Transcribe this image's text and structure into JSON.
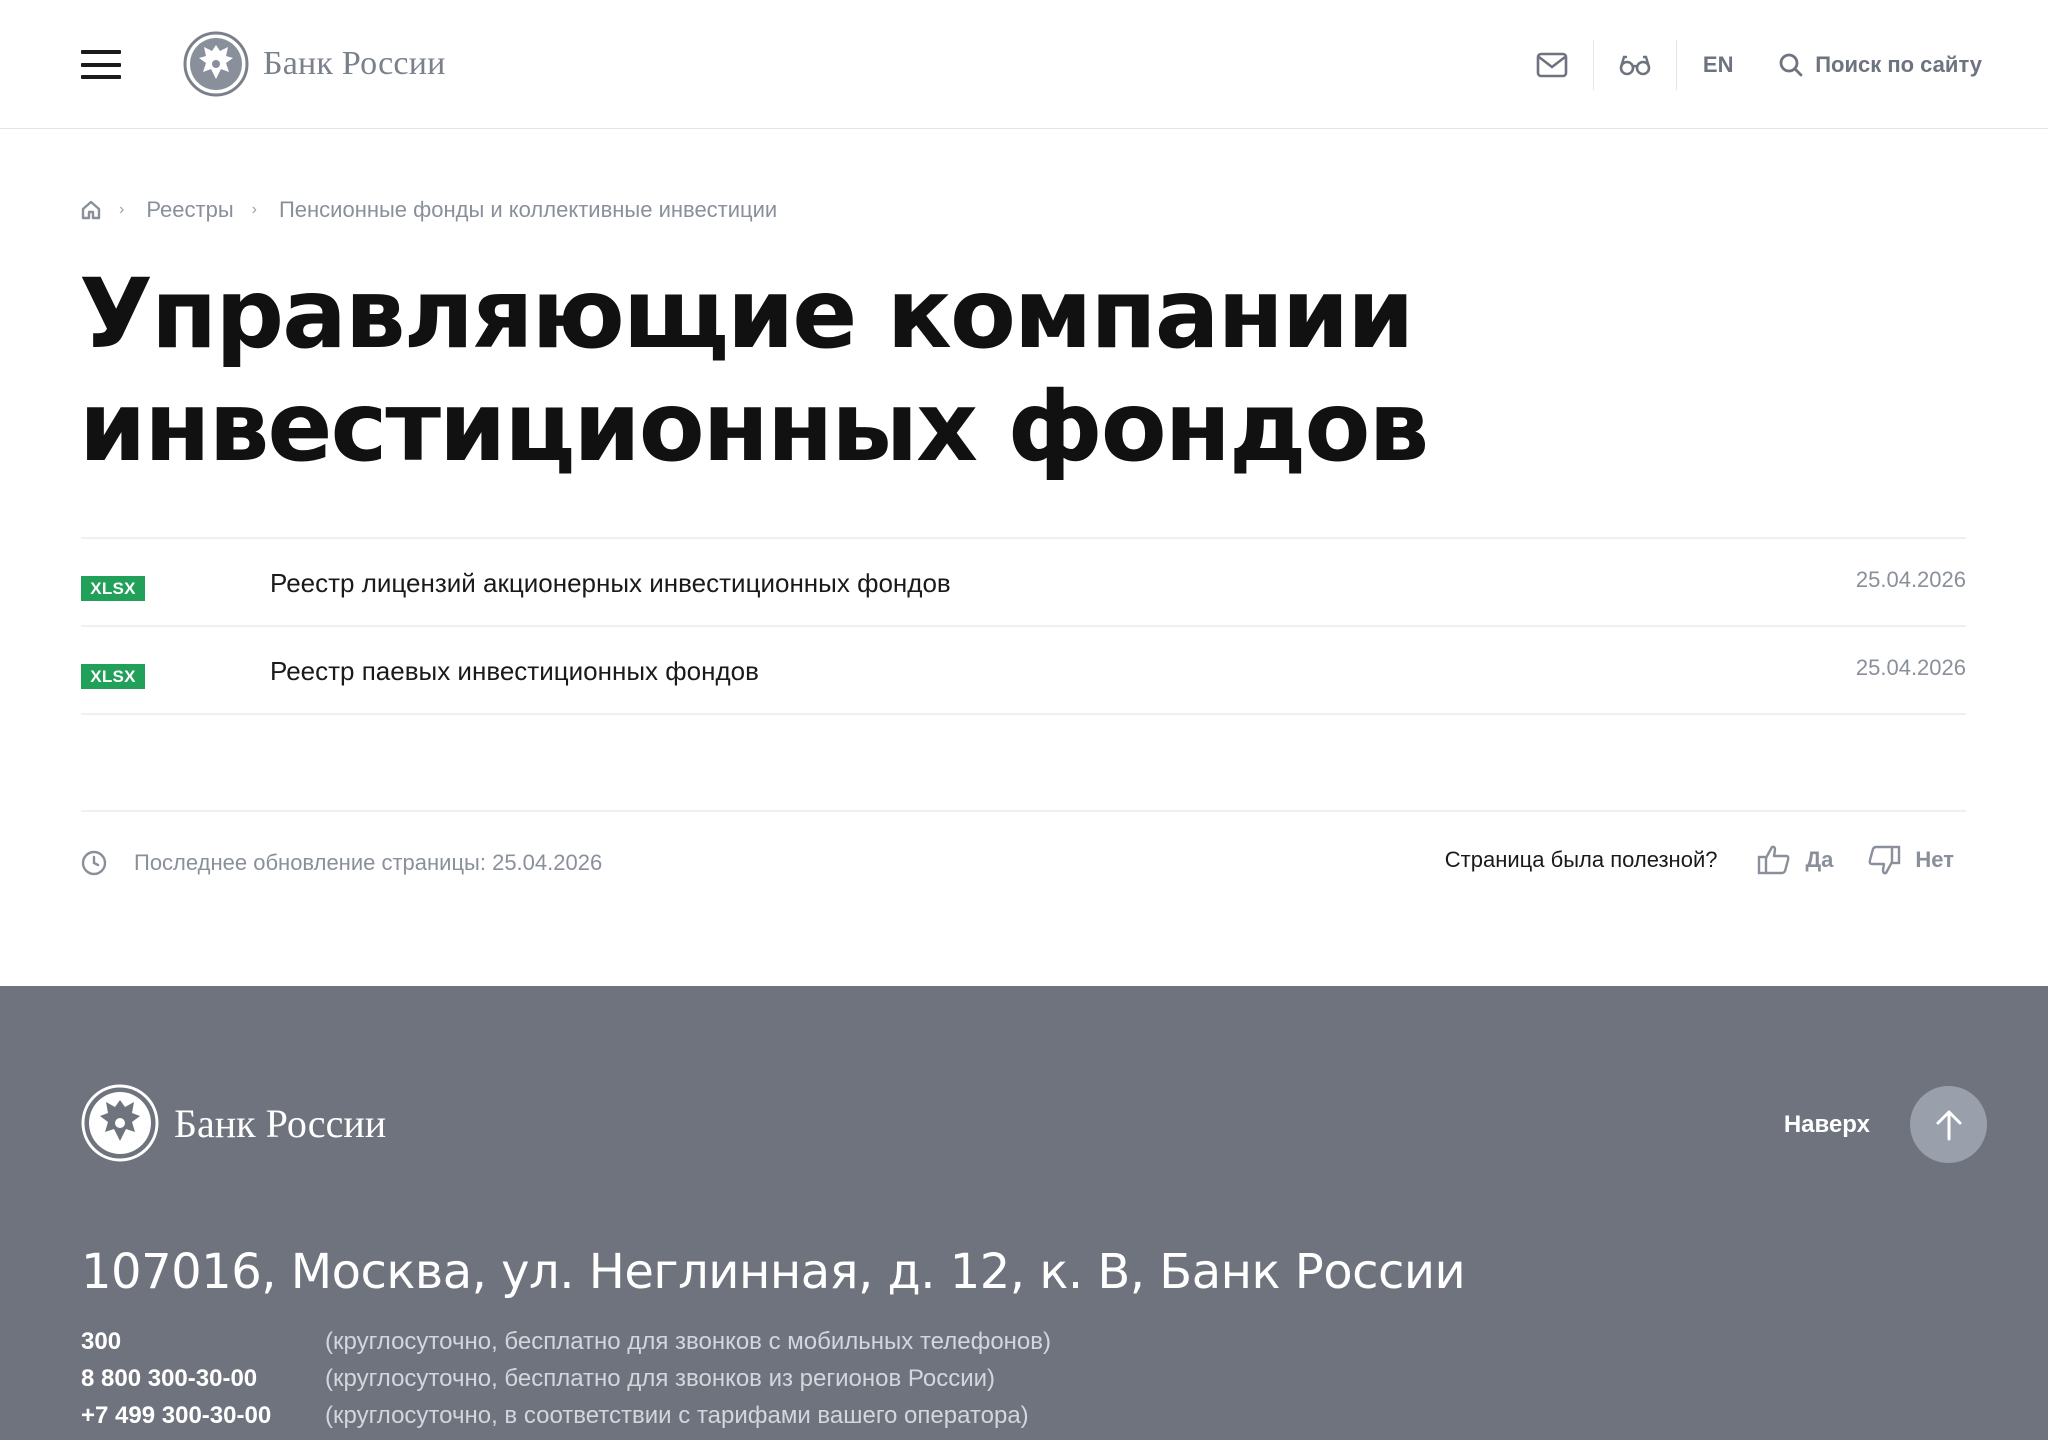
{
  "header": {
    "logo_text": "Банк России",
    "lang": "EN",
    "search_label": "Поиск по сайту"
  },
  "breadcrumb": [
    "Реестры",
    "Пенсионные фонды и коллективные инвестиции"
  ],
  "page": {
    "title": "Управляющие компании инвестиционных фондов"
  },
  "documents": [
    {
      "format": "XLSX",
      "title": "Реестр лицензий акционерных инвестиционных фондов",
      "date": "25.04.2026"
    },
    {
      "format": "XLSX",
      "title": "Реестр паевых инвестиционных фондов",
      "date": "25.04.2026"
    }
  ],
  "meta": {
    "updated": "Последнее обновление страницы: 25.04.2026",
    "feedback_question": "Страница была полезной?",
    "yes": "Да",
    "no": "Нет"
  },
  "footer": {
    "logo_text": "Банк России",
    "to_top": "Наверх",
    "address": "107016, Москва, ул. Неглинная, д. 12, к. В, Банк России",
    "phones": [
      {
        "number": "300",
        "note": "(круглосуточно, бесплатно для звонков с мобильных телефонов)"
      },
      {
        "number": "8 800 300-30-00",
        "note": "(круглосуточно, бесплатно для звонков из регионов России)"
      },
      {
        "number": "+7 499 300-30-00",
        "note": "(круглосуточно, в соответствии с тарифами вашего оператора)"
      }
    ]
  },
  "colors": {
    "badge_green": "#21a05a",
    "footer_bg": "#6f737e",
    "muted_text": "#8a909b"
  },
  "icons": [
    "menu-icon",
    "emblem-icon",
    "mail-icon",
    "glasses-icon",
    "search-icon",
    "home-icon",
    "clock-icon",
    "thumb-up-icon",
    "thumb-down-icon",
    "arrow-up-icon"
  ]
}
